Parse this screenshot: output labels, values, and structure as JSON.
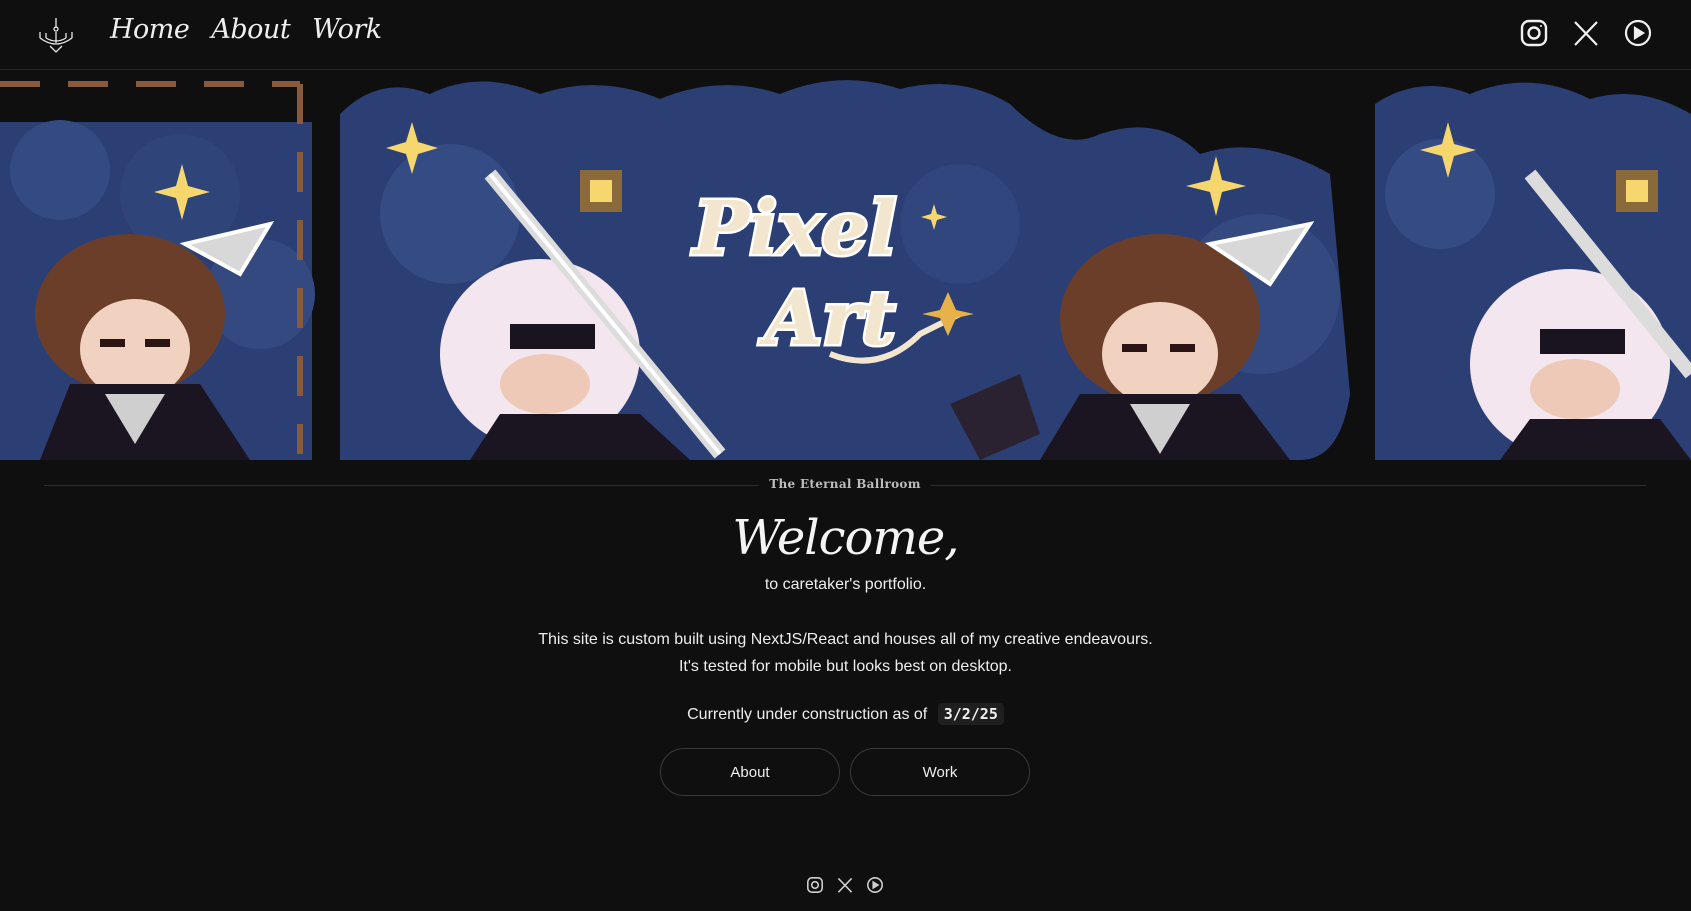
{
  "nav": {
    "logo_icon": "chandelier-icon",
    "links": [
      {
        "label": "Home"
      },
      {
        "label": "About"
      },
      {
        "label": "Work"
      }
    ],
    "social": [
      {
        "icon": "instagram-icon"
      },
      {
        "icon": "x-icon"
      },
      {
        "icon": "play-circle-icon"
      }
    ]
  },
  "banner": {
    "title_art": "Pixel Art"
  },
  "divider": {
    "label": "The Eternal Ballroom"
  },
  "hero": {
    "title": "Welcome,",
    "subtitle": "to caretaker's portfolio.",
    "desc_line1": "This site is custom built using NextJS/React and houses all of my creative endeavours.",
    "desc_line2": "It's tested for mobile but looks best on desktop.",
    "construction_text": "Currently under construction as of",
    "construction_date": "3/2/25"
  },
  "buttons": {
    "about_label": "About",
    "work_label": "Work"
  },
  "footer": {
    "social": [
      {
        "icon": "instagram-icon"
      },
      {
        "icon": "x-icon"
      },
      {
        "icon": "play-circle-icon"
      }
    ]
  },
  "colors": {
    "background": "#0f0f0f",
    "banner_sky": "#2c3f74",
    "banner_sky_light": "#3d5a93",
    "star": "#f5d76e",
    "text": "#f2f2f2"
  }
}
